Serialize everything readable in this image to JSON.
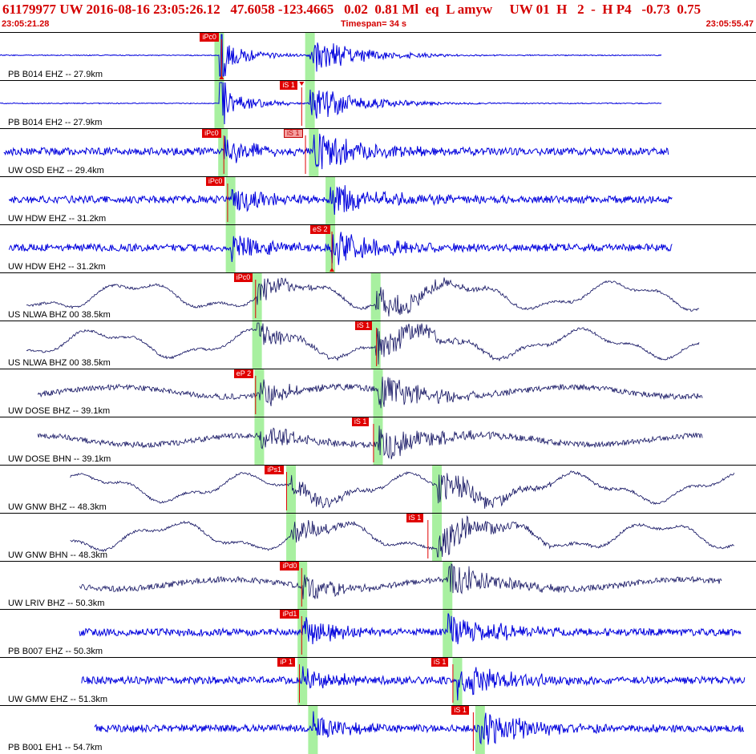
{
  "header": {
    "title": "61179977 UW 2016-08-16 23:05:26.12   47.6058 -123.4665   0.02  0.81 Ml  eq  L amyw     UW 01  H   2  -  H P4   -0.73  0.75",
    "start_time": "23:05:21.28",
    "timespan": "Timespan=  34 s",
    "end_time": "23:05:55.47"
  },
  "colors": {
    "title_red": "#d40000",
    "trace_blue": "#0000dd",
    "trace_dark": "#101060",
    "pick_red": "#e00000",
    "window_green": "#a8f0a0"
  },
  "traces": [
    {
      "label": "PB B014 EHZ -- 27.9km",
      "style": "blue",
      "amp": "spike",
      "start": 0,
      "end": 0.875,
      "picks": [
        {
          "text": "iPc0",
          "at": 0.292,
          "light": false
        }
      ],
      "windows": [
        0.29,
        0.41
      ],
      "triangle": "bottom"
    },
    {
      "label": "PB B014 EH2 -- 27.9km",
      "style": "blue",
      "amp": "spike",
      "start": 0,
      "end": 0.875,
      "picks": [
        {
          "text": "iS 1",
          "at": 0.398,
          "light": false
        }
      ],
      "windows": [
        0.29,
        0.41
      ],
      "triangle": "top"
    },
    {
      "label": "UW OSD EHZ -- 29.4km",
      "style": "blue",
      "amp": "noise",
      "start": 0.005,
      "end": 0.885,
      "picks": [
        {
          "text": "iPc0",
          "at": 0.295,
          "light": false
        },
        {
          "text": "iS 1",
          "at": 0.403,
          "light": true
        }
      ],
      "windows": [
        0.295,
        0.415
      ],
      "triangle": ""
    },
    {
      "label": "UW HDW EHZ -- 31.2km",
      "style": "blue",
      "amp": "noise",
      "start": 0.012,
      "end": 0.89,
      "picks": [
        {
          "text": "iPc0",
          "at": 0.3,
          "light": false
        }
      ],
      "windows": [
        0.305,
        0.437
      ],
      "triangle": ""
    },
    {
      "label": "UW HDW EH2 -- 31.2km",
      "style": "blue",
      "amp": "noise",
      "start": 0.012,
      "end": 0.89,
      "picks": [
        {
          "text": "eS 2",
          "at": 0.438,
          "light": false
        }
      ],
      "windows": [
        0.305,
        0.437
      ],
      "triangle": "bottom"
    },
    {
      "label": "US NLWA BHZ 00 38.5km",
      "style": "dark",
      "amp": "wave",
      "start": 0.035,
      "end": 0.925,
      "picks": [
        {
          "text": "iPc0",
          "at": 0.337,
          "light": false
        }
      ],
      "windows": [
        0.34,
        0.497
      ],
      "triangle": ""
    },
    {
      "label": "US NLWA BHZ 00 38.5km",
      "style": "dark",
      "amp": "wave",
      "start": 0.035,
      "end": 0.925,
      "picks": [
        {
          "text": "iS 1",
          "at": 0.497,
          "light": false
        }
      ],
      "windows": [
        0.34,
        0.497
      ],
      "triangle": ""
    },
    {
      "label": "UW DOSE BHZ -- 39.1km",
      "style": "dark",
      "amp": "dense",
      "start": 0.05,
      "end": 0.93,
      "picks": [
        {
          "text": "eP 2",
          "at": 0.337,
          "light": false
        }
      ],
      "windows": [
        0.343,
        0.5
      ],
      "triangle": ""
    },
    {
      "label": "UW DOSE BHN -- 39.1km",
      "style": "dark",
      "amp": "dense",
      "start": 0.05,
      "end": 0.93,
      "picks": [
        {
          "text": "iS 1",
          "at": 0.493,
          "light": false
        }
      ],
      "windows": [
        0.343,
        0.5
      ],
      "triangle": ""
    },
    {
      "label": "UW GNW BHZ -- 48.3km",
      "style": "dark",
      "amp": "wave",
      "start": 0.093,
      "end": 0.972,
      "picks": [
        {
          "text": "iPs1",
          "at": 0.378,
          "light": false
        }
      ],
      "windows": [
        0.385,
        0.578
      ],
      "triangle": ""
    },
    {
      "label": "UW GNW BHN -- 48.3km",
      "style": "dark",
      "amp": "wave",
      "start": 0.093,
      "end": 0.972,
      "picks": [
        {
          "text": "iS 1",
          "at": 0.565,
          "light": false
        }
      ],
      "windows": [
        0.385,
        0.578
      ],
      "triangle": ""
    },
    {
      "label": "UW LRIV BHZ -- 50.3km",
      "style": "dark",
      "amp": "dense",
      "start": 0.105,
      "end": 0.955,
      "picks": [
        {
          "text": "iPd0",
          "at": 0.398,
          "light": false
        }
      ],
      "windows": [
        0.4,
        0.592
      ],
      "triangle": ""
    },
    {
      "label": "PB B007 EHZ -- 50.3km",
      "style": "blue",
      "amp": "noise",
      "start": 0.105,
      "end": 0.98,
      "picks": [
        {
          "text": "iPd1",
          "at": 0.398,
          "light": false
        }
      ],
      "windows": [
        0.4,
        0.592
      ],
      "triangle": ""
    },
    {
      "label": "UW GMW EHZ -- 51.3km",
      "style": "blue",
      "amp": "noise",
      "start": 0.108,
      "end": 0.985,
      "picks": [
        {
          "text": "iP 1",
          "at": 0.395,
          "light": false
        },
        {
          "text": "iS 1",
          "at": 0.598,
          "light": false
        }
      ],
      "windows": [
        0.4,
        0.605
      ],
      "triangle": ""
    },
    {
      "label": "PB B001 EH1 -- 54.7km",
      "style": "blue",
      "amp": "noise",
      "start": 0.125,
      "end": 0.985,
      "picks": [
        {
          "text": "iS 1",
          "at": 0.625,
          "light": false
        }
      ],
      "windows": [
        0.414,
        0.635
      ],
      "triangle": ""
    }
  ]
}
